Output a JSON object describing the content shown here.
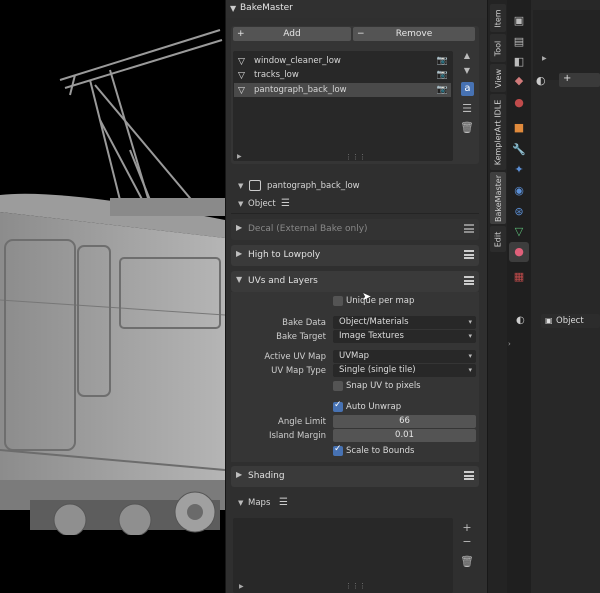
{
  "panel": {
    "title": "BakeMaster",
    "add_label": "Add",
    "remove_label": "Remove",
    "objects": [
      {
        "name": "window_cleaner_low",
        "selected": false
      },
      {
        "name": "tracks_low",
        "selected": false
      },
      {
        "name": "pantograph_back_low",
        "selected": true
      }
    ],
    "active_object": "pantograph_back_low",
    "object_label": "Object",
    "sections": {
      "decal": "Decal (External Bake only)",
      "high_to_lowpoly": "High to Lowpoly",
      "uvs_and_layers": "UVs and Layers",
      "shading": "Shading",
      "maps": "Maps"
    },
    "uvs": {
      "unique_per_map": "Unique per map",
      "bake_data_label": "Bake Data",
      "bake_data_value": "Object/Materials",
      "bake_target_label": "Bake Target",
      "bake_target_value": "Image Textures",
      "active_uv_label": "Active UV Map",
      "active_uv_value": "UVMap",
      "uv_map_type_label": "UV Map Type",
      "uv_map_type_value": "Single (single tile)",
      "snap_uv": "Snap UV to pixels",
      "auto_unwrap": "Auto Unwrap",
      "angle_limit_label": "Angle Limit",
      "angle_limit_value": "66",
      "island_margin_label": "Island Margin",
      "island_margin_value": "0.01",
      "scale_to_bounds": "Scale to Bounds"
    }
  },
  "tabs": [
    "Item",
    "Tool",
    "View",
    "KemplerArt IDLE",
    "BakeMaster",
    "Edit"
  ],
  "right": {
    "object_label": "Object"
  },
  "colors": {
    "accent": "#4772b3",
    "panel": "#2f2f2f",
    "section": "#3a3a3a"
  }
}
